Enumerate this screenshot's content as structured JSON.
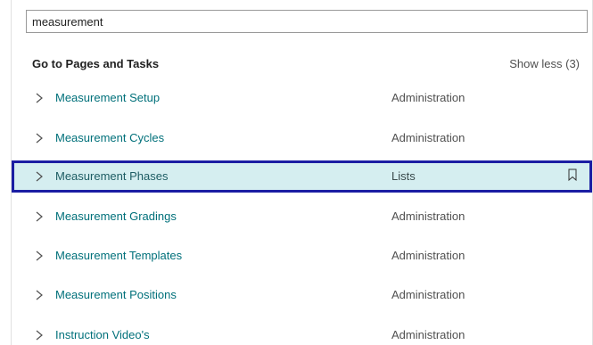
{
  "search": {
    "value": "measurement"
  },
  "section": {
    "title": "Go to Pages and Tasks",
    "toggle_label": "Show less (3)"
  },
  "results": [
    {
      "name": "Measurement Setup",
      "category": "Administration",
      "selected": false
    },
    {
      "name": "Measurement Cycles",
      "category": "Administration",
      "selected": false
    },
    {
      "name": "Measurement Phases",
      "category": "Lists",
      "selected": true
    },
    {
      "name": "Measurement Gradings",
      "category": "Administration",
      "selected": false
    },
    {
      "name": "Measurement Templates",
      "category": "Administration",
      "selected": false
    },
    {
      "name": "Measurement Positions",
      "category": "Administration",
      "selected": false
    },
    {
      "name": "Instruction Video's",
      "category": "Administration",
      "selected": false
    }
  ],
  "icons": {
    "row_expand": "chevron-right-icon",
    "bookmark": "bookmark-icon"
  },
  "colors": {
    "link": "#00707a",
    "selection_fill": "#d5eef0",
    "selection_border": "#1b1ea3"
  }
}
